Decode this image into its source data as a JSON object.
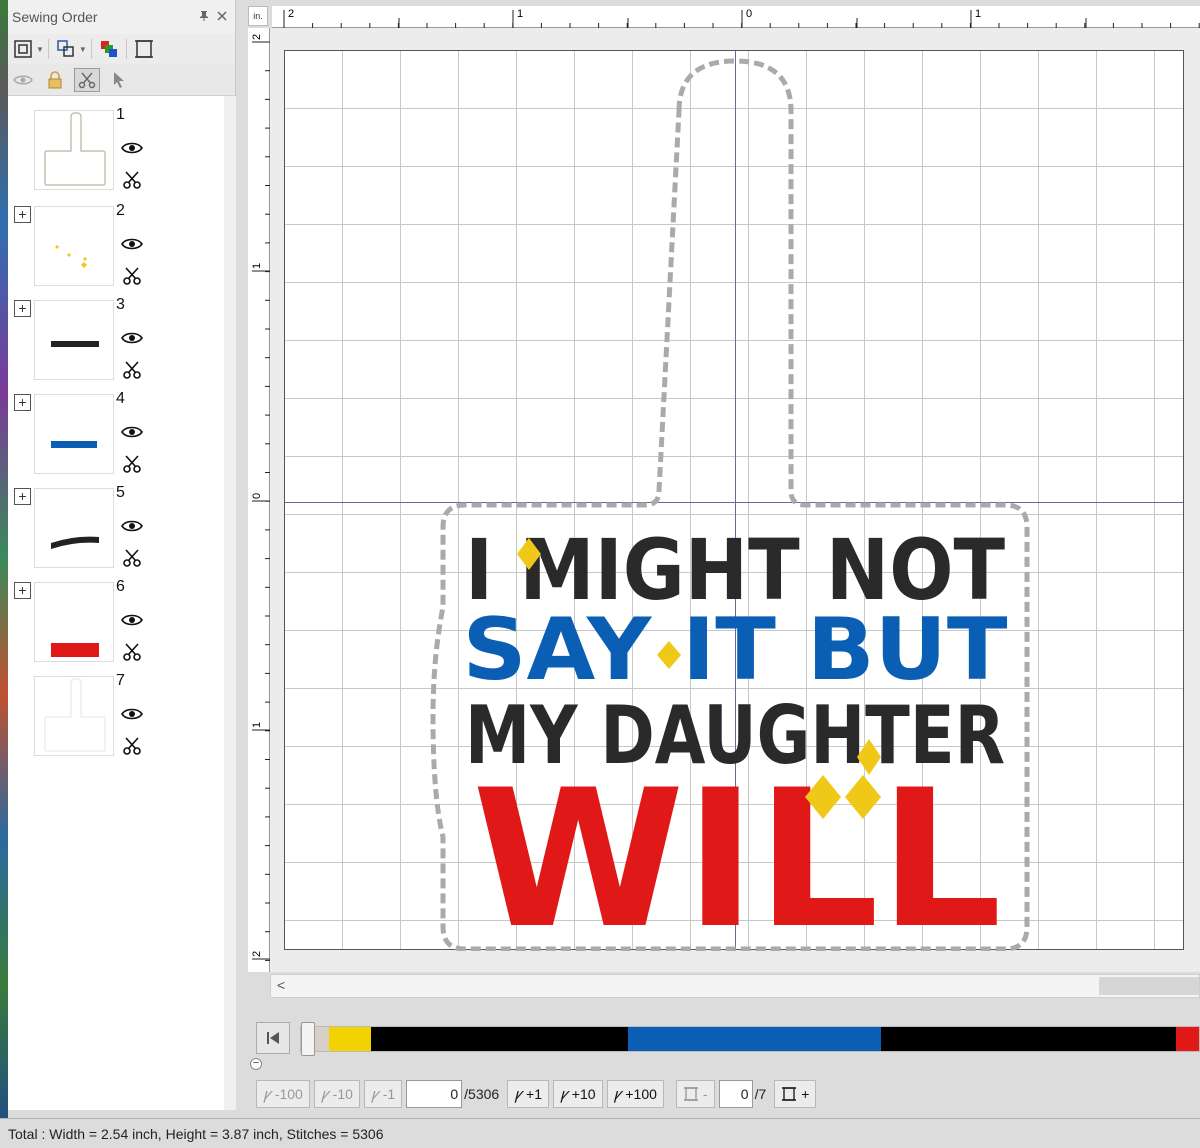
{
  "panel": {
    "title": "Sewing Order",
    "pin_icon": "pin-icon",
    "close_icon": "close-icon",
    "items": [
      {
        "number": "1"
      },
      {
        "number": "2"
      },
      {
        "number": "3"
      },
      {
        "number": "4"
      },
      {
        "number": "5"
      },
      {
        "number": "6"
      },
      {
        "number": "7"
      }
    ]
  },
  "rulers": {
    "unit": "in.",
    "top_labels": [
      "2",
      "1",
      "0",
      "1"
    ],
    "left_labels": [
      "2",
      "1",
      "0",
      "1",
      "2"
    ]
  },
  "design": {
    "line1": "I MIGHT NOT",
    "line2": "SAY IT BUT",
    "line3": "MY DAUGHTER",
    "line4": "WILL",
    "colors": {
      "black": "#2a2a2a",
      "blue": "#0a5fb4",
      "red": "#e01818",
      "yellow": "#f0c818",
      "outline": "#aaaaaa"
    }
  },
  "sequence": {
    "colors": [
      "#d8d0c8",
      "#f2d200",
      "#000000",
      "#0a5fb4",
      "#000000",
      "#e01818"
    ]
  },
  "controls": {
    "back100": "-100",
    "back10": "-10",
    "back1": "-1",
    "stitch_value": "0",
    "stitch_total": "/5306",
    "fwd1": "+1",
    "fwd10": "+10",
    "fwd100": "+100",
    "color_minus": "-",
    "color_value": "0",
    "color_total": "/7",
    "color_plus": "+"
  },
  "status": {
    "text": "Total : Width = 2.54 inch, Height = 3.87 inch, Stitches = 5306"
  }
}
